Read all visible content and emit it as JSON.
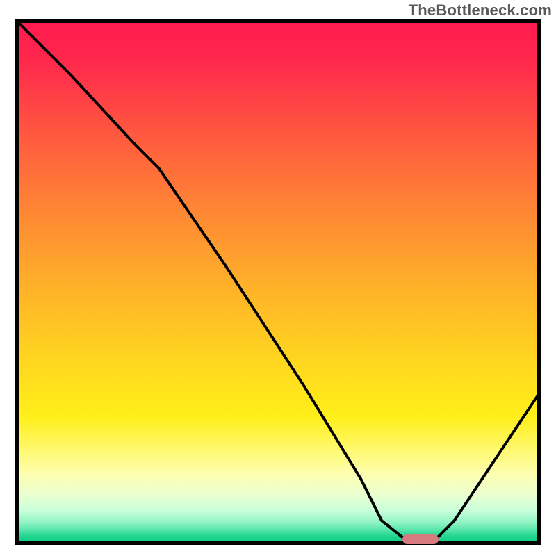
{
  "watermark": "TheBottleneck.com",
  "colors": {
    "curve_stroke": "#000000",
    "marker_fill": "#d57a7e",
    "frame_stroke": "#000000"
  },
  "chart_data": {
    "type": "line",
    "title": "",
    "xlabel": "",
    "ylabel": "",
    "xlim": [
      0,
      100
    ],
    "ylim": [
      0,
      100
    ],
    "grid": false,
    "legend": false,
    "series": [
      {
        "name": "bottleneck-curve",
        "x": [
          0,
          10,
          22,
          27,
          40,
          55,
          66,
          70,
          75,
          80,
          84,
          100
        ],
        "values": [
          100,
          90,
          77,
          72,
          53,
          30,
          12,
          4,
          0,
          0,
          4,
          28
        ]
      }
    ],
    "markers": [
      {
        "name": "optimal-range",
        "x_start": 74,
        "x_end": 81,
        "y": 0
      }
    ],
    "gradient_stops": [
      {
        "pos": 0,
        "color": "#ff1a4f"
      },
      {
        "pos": 0.5,
        "color": "#ffc024"
      },
      {
        "pos": 0.8,
        "color": "#fff65a"
      },
      {
        "pos": 0.95,
        "color": "#aef3cc"
      },
      {
        "pos": 1.0,
        "color": "#0fcf84"
      }
    ]
  }
}
